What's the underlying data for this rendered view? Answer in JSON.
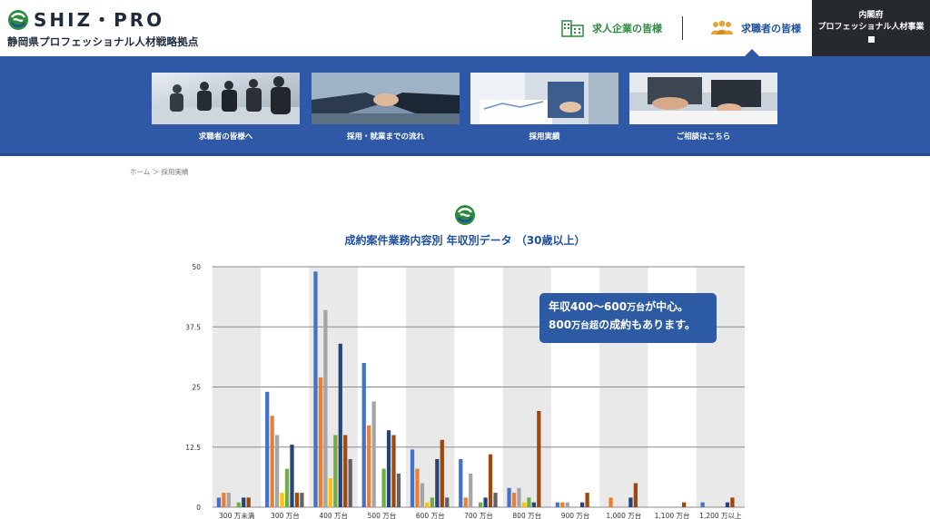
{
  "header": {
    "logo_text": "SHIZ・PRO",
    "logo_sub": "静岡県プロフェッショナル人材戦略拠点",
    "nav_companies": "求人企業の皆様",
    "nav_seekers": "求職者の皆様",
    "cabinet_line1": "内閣府",
    "cabinet_line2": "プロフェッショナル人材事業"
  },
  "cards": [
    {
      "label": "求職者の皆様へ"
    },
    {
      "label": "採用・就業までの流れ"
    },
    {
      "label": "採用実績"
    },
    {
      "label": "ご相談はこちら"
    }
  ],
  "breadcrumb": "ホーム ＞ 採用実績",
  "section_title": "成約案件業務内容別 年収別データ （30歳以上）",
  "callout": {
    "line1_a": "年収400〜600",
    "line1_small": "万台",
    "line1_b": "が中心。",
    "line2_a": "800",
    "line2_small": "万台超",
    "line2_b": "の成約もあります。"
  },
  "colors": {
    "brand_blue": "#2f59a6",
    "brand_green": "#2b8a3e",
    "series": [
      "#4472c4",
      "#ed7d31",
      "#a5a5a5",
      "#ffc000",
      "#70ad47",
      "#264478",
      "#9e480e",
      "#636363",
      "#997300"
    ]
  },
  "chart_data": {
    "type": "bar",
    "categories": [
      "300 万未満",
      "300 万台",
      "400 万台",
      "500 万台",
      "600 万台",
      "700 万台",
      "800 万台",
      "900 万台",
      "1,000 万台",
      "1,100 万台",
      "1,200 万以上"
    ],
    "ylim": [
      0,
      50
    ],
    "yticks": [
      "0",
      "12.5",
      "25",
      "37.5",
      "50"
    ],
    "series": [
      {
        "values": [
          2,
          24,
          49,
          30,
          12,
          10,
          4,
          1,
          0,
          0,
          1
        ]
      },
      {
        "values": [
          3,
          19,
          27,
          17,
          8,
          2,
          3,
          1,
          2,
          0,
          0
        ]
      },
      {
        "values": [
          3,
          15,
          41,
          22,
          5,
          7,
          4,
          1,
          0,
          0,
          0
        ]
      },
      {
        "values": [
          0,
          3,
          6,
          0,
          1,
          0,
          1,
          0,
          0,
          0,
          0
        ]
      },
      {
        "values": [
          1,
          8,
          15,
          8,
          2,
          1,
          2,
          0,
          0,
          0,
          0
        ]
      },
      {
        "values": [
          2,
          13,
          34,
          16,
          10,
          2,
          1,
          1,
          2,
          0,
          1
        ]
      },
      {
        "values": [
          2,
          3,
          15,
          15,
          14,
          11,
          20,
          3,
          5,
          1,
          2
        ]
      },
      {
        "values": [
          0,
          3,
          10,
          7,
          2,
          3,
          0,
          0,
          0,
          0,
          0
        ]
      }
    ]
  }
}
